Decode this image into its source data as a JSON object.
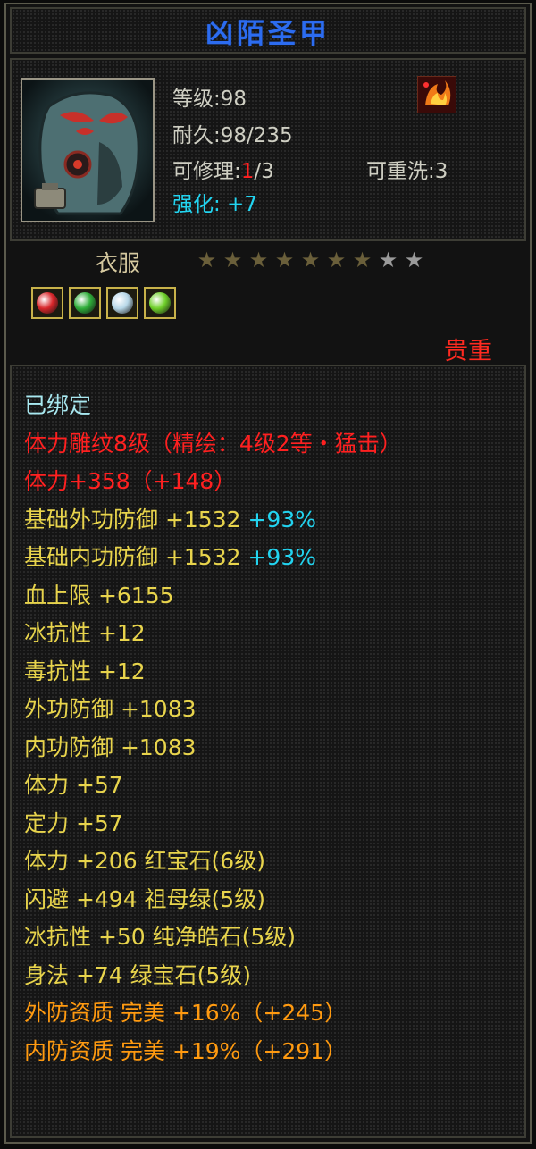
{
  "item": {
    "name": "凶陌圣甲",
    "level_label": "等级",
    "level": ":98",
    "durability_label": "耐久",
    "durability": ":98/235",
    "repair_label": "可修理",
    "repair_prefix": ":",
    "repair_current": "1",
    "repair_max": "/3",
    "rewash_label": "可重洗",
    "rewash": ":3",
    "enhance_label": "强化",
    "enhance": ": +7",
    "slot": "衣服",
    "stars_total": 9,
    "stars_filled": 7,
    "grade": "贵重",
    "portrait_icon": "armor-mask-icon",
    "class_icon": "flame-class-icon"
  },
  "gems": [
    {
      "icon": "red-gem-icon",
      "color": "#d8262a"
    },
    {
      "icon": "green-gem-icon",
      "color": "#2fae3a"
    },
    {
      "icon": "pure-white-gem-icon",
      "color": "#b8d8e8"
    },
    {
      "icon": "green-stone-gem-icon",
      "color": "#6fd02a"
    }
  ],
  "stats": [
    {
      "text": "已绑定",
      "color": "lt-cyan"
    },
    {
      "text": "体力雕纹8级（精绘：4级2等・猛击）",
      "color": "lt-red"
    },
    {
      "text": "体力+358（+148）",
      "color": "lt-red"
    },
    {
      "text": "基础外功防御 +1532",
      "extra": " +93%",
      "color": "yellow"
    },
    {
      "text": "基础内功防御 +1532",
      "extra": " +93%",
      "color": "yellow"
    },
    {
      "text": "血上限 +6155",
      "color": "yellow"
    },
    {
      "text": "冰抗性 +12",
      "color": "yellow"
    },
    {
      "text": "毒抗性 +12",
      "color": "yellow"
    },
    {
      "text": "外功防御 +1083",
      "color": "yellow"
    },
    {
      "text": "内功防御 +1083",
      "color": "yellow"
    },
    {
      "text": "体力 +57",
      "color": "yellow"
    },
    {
      "text": "定力 +57",
      "color": "yellow"
    },
    {
      "text": "体力 +206 红宝石(6级)",
      "color": "yellow"
    },
    {
      "text": "闪避 +494 祖母绿(5级)",
      "color": "yellow"
    },
    {
      "text": "冰抗性 +50 纯净皓石(5级)",
      "color": "yellow"
    },
    {
      "text": "身法 +74 绿宝石(5级)",
      "color": "yellow"
    },
    {
      "text": "外防资质  完美 +16%（+245）",
      "color": "orange"
    },
    {
      "text": "内防资质  完美 +19%（+291）",
      "color": "orange"
    }
  ]
}
